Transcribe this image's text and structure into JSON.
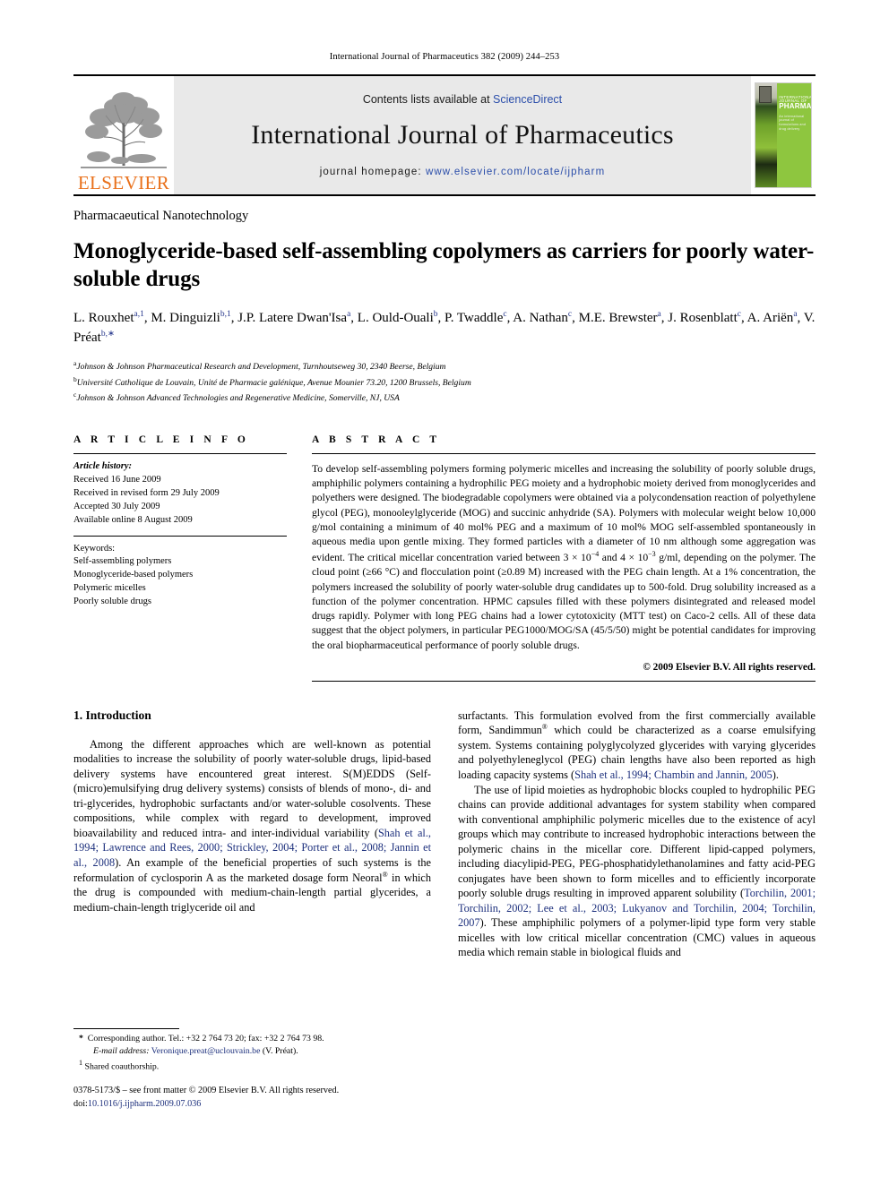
{
  "running_head": "International Journal of Pharmaceutics 382 (2009) 244–253",
  "masthead": {
    "publisher_name": "ELSEVIER",
    "contents_prefix": "Contents lists available at ",
    "contents_link": "ScienceDirect",
    "journal_title": "International Journal of Pharmaceutics",
    "homepage_prefix": "journal homepage: ",
    "homepage_url": "www.elsevier.com/locate/ijpharm",
    "cover_line1": "INTERNATIONAL JOURNAL OF",
    "cover_line2": "PHARMACEUTICS",
    "cover_line3": "An international journal of formulations and drug delivery"
  },
  "section_label": "Pharmacaeutical Nanotechnology",
  "article_title": "Monoglyceride-based self-assembling copolymers as carriers for poorly water-soluble drugs",
  "authors_html": "L. Rouxhet<sup>a,1</sup>, M. Dinguizli<sup>b,1</sup>, J.P. Latere Dwan'Isa<sup>a</sup>, L. Ould-Ouali<sup>b</sup>, P. Twaddle<sup>c</sup>, A. Nathan<sup>c</sup>, M.E. Brewster<sup>a</sup>, J. Rosenblatt<sup>c</sup>, A. Ariën<sup>a</sup>, V. Préat<sup>b,<span class=\"star\">∗</span></sup>",
  "affiliations": [
    {
      "mark": "a",
      "text": "Johnson & Johnson Pharmaceutical Research and Development, Turnhoutseweg 30, 2340 Beerse, Belgium"
    },
    {
      "mark": "b",
      "text": "Université Catholique de Louvain, Unité de Pharmacie galénique, Avenue Mounier 73.20, 1200 Brussels, Belgium"
    },
    {
      "mark": "c",
      "text": "Johnson & Johnson Advanced Technologies and Regenerative Medicine, Somerville, NJ, USA"
    }
  ],
  "article_info": {
    "heading": "A R T I C L E    I N F O",
    "history_label": "Article history:",
    "history": [
      "Received 16 June 2009",
      "Received in revised form 29 July 2009",
      "Accepted 30 July 2009",
      "Available online 8 August 2009"
    ],
    "keywords_label": "Keywords:",
    "keywords": [
      "Self-assembling polymers",
      "Monoglyceride-based polymers",
      "Polymeric micelles",
      "Poorly soluble drugs"
    ]
  },
  "abstract": {
    "heading": "A B S T R A C T",
    "text_html": "To develop self-assembling polymers forming polymeric micelles and increasing the solubility of poorly soluble drugs, amphiphilic polymers containing a hydrophilic PEG moiety and a hydrophobic moiety derived from monoglycerides and polyethers were designed. The biodegradable copolymers were obtained via a polycondensation reaction of polyethylene glycol (PEG), monooleylglyceride (MOG) and succinic anhydride (SA). Polymers with molecular weight below 10,000 g/mol containing a minimum of 40 mol% PEG and a maximum of 10 mol% MOG self-assembled spontaneously in aqueous media upon gentle mixing. They formed particles with a diameter of 10 nm although some aggregation was evident. The critical micellar concentration varied between 3 × 10<sup class=\"sup-r\">−4</sup> and 4 × 10<sup class=\"sup-r\">−3</sup> g/ml, depending on the polymer. The cloud point (&ge;66 &deg;C) and flocculation point (&ge;0.89 M) increased with the PEG chain length. At a 1% concentration, the polymers increased the solubility of poorly water-soluble drug candidates up to 500-fold. Drug solubility increased as a function of the polymer concentration. HPMC capsules filled with these polymers disintegrated and released model drugs rapidly. Polymer with long PEG chains had a lower cytotoxicity (MTT test) on Caco-2 cells. All of these data suggest that the object polymers, in particular PEG1000/MOG/SA (45/5/50) might be potential candidates for improving the oral biopharmaceutical performance of poorly soluble drugs.",
    "copyright": "© 2009 Elsevier B.V. All rights reserved."
  },
  "body": {
    "intro_heading": "1.  Introduction",
    "left_paragraphs_html": [
      "Among the different approaches which are well-known as potential modalities to increase the solubility of poorly water-soluble drugs, lipid-based delivery systems have encountered great interest. S(M)EDDS (Self-(micro)emulsifying drug delivery systems) consists of blends of mono-, di- and tri-glycerides, hydrophobic surfactants and/or water-soluble cosolvents. These compositions, while complex with regard to development, improved bioavailability and reduced intra- and inter-individual variability (<span class=\"cite\">Shah et al., 1994; Lawrence and Rees, 2000; Strickley, 2004; Porter et al., 2008; Jannin et al., 2008</span>). An example of the beneficial properties of such systems is the reformulation of cyclosporin A as the marketed dosage form Neoral<sup class=\"sup-r\">®</sup> in which the drug is compounded with medium-chain-length partial glycerides, a medium-chain-length triglyceride oil and"
    ],
    "right_paragraphs_html": [
      "surfactants. This formulation evolved from the first commercially available form, Sandimmun<sup class=\"sup-r\">®</sup> which could be characterized as a coarse emulsifying system. Systems containing polyglycolyzed glycerides with varying glycerides and polyethyleneglycol (PEG) chain lengths have also been reported as high loading capacity systems (<span class=\"cite\">Shah et al., 1994; Chambin and Jannin, 2005</span>).",
      "The use of lipid moieties as hydrophobic blocks coupled to hydrophilic PEG chains can provide additional advantages for system stability when compared with conventional amphiphilic polymeric micelles due to the existence of acyl groups which may contribute to increased hydrophobic interactions between the polymeric chains in the micellar core. Different lipid-capped polymers, including diacylipid-PEG, PEG-phosphatidylethanolamines and fatty acid-PEG conjugates have been shown to form micelles and to efficiently incorporate poorly soluble drugs resulting in improved apparent solubility (<span class=\"cite\">Torchilin, 2001; Torchilin, 2002; Lee et al., 2003; Lukyanov and Torchilin, 2004; Torchilin, 2007</span>). These amphiphilic polymers of a polymer-lipid type form very stable micelles with low critical micellar concentration (CMC) values in aqueous media which remain stable in biological fluids and"
    ]
  },
  "footnotes": {
    "corresponding_html": "<b>*</b>&nbsp; Corresponding author. Tel.: +32 2 764 73 20; fax: +32 2 764 73 98.",
    "email_html": "<span class=\"it\">E-mail address:</span> <span class=\"link\">Veronique.preat@uclouvain.be</span> (V. Préat).",
    "shared_html": "<sup>1</sup> Shared coauthorship.",
    "issn_html": "0378-5173/$ – see front matter © 2009 Elsevier B.V. All rights reserved.",
    "doi_prefix": "doi:",
    "doi_value": "10.1016/j.ijpharm.2009.07.036"
  }
}
